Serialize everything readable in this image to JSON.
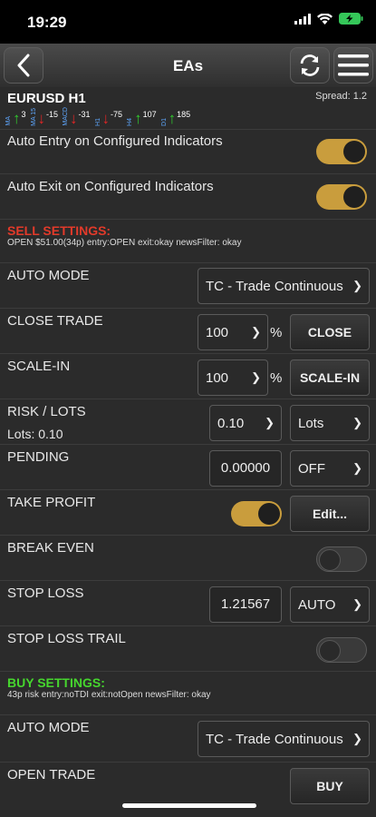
{
  "status": {
    "time": "19:29"
  },
  "nav": {
    "title": "EAs",
    "back_icon": "chevron-left-icon",
    "refresh_icon": "refresh-icon",
    "menu_icon": "hamburger-menu-icon"
  },
  "symbol": {
    "name": "EURUSD H1",
    "spread": "Spread: 1.2"
  },
  "indicators": [
    {
      "label": "MA",
      "dir": "up",
      "value": "3"
    },
    {
      "label": "MA 15",
      "dir": "down",
      "value": "-15"
    },
    {
      "label": "MACD",
      "dir": "down",
      "value": "-31"
    },
    {
      "label": "H1",
      "dir": "down",
      "value": "-75"
    },
    {
      "label": "H4",
      "dir": "up",
      "value": "107"
    },
    {
      "label": "D1",
      "dir": "up",
      "value": "185"
    }
  ],
  "auto_entry": {
    "label": "Auto Entry on Configured Indicators",
    "enabled": true
  },
  "auto_exit": {
    "label": "Auto Exit on Configured Indicators",
    "enabled": true
  },
  "sell": {
    "title": "SELL SETTINGS:",
    "summary": "OPEN $51.00(34p) entry:OPEN exit:okay newsFilter: okay",
    "auto_mode": {
      "label": "AUTO MODE",
      "value": "TC - Trade Continuous"
    },
    "close_trade": {
      "label": "CLOSE TRADE",
      "value": "100",
      "unit": "%",
      "button": "CLOSE"
    },
    "scale_in": {
      "label": "SCALE-IN",
      "value": "100",
      "unit": "%",
      "button": "SCALE-IN"
    },
    "risk": {
      "label": "RISK / LOTS",
      "sub": "Lots: 0.10",
      "value": "0.10",
      "type": "Lots"
    },
    "pending": {
      "label": "PENDING",
      "value": "0.00000",
      "mode": "OFF"
    },
    "take_profit": {
      "label": "TAKE PROFIT",
      "enabled": true,
      "button": "Edit..."
    },
    "break_even": {
      "label": "BREAK EVEN",
      "enabled": false
    },
    "stop_loss": {
      "label": "STOP LOSS",
      "value": "1.21567",
      "mode": "AUTO"
    },
    "stop_loss_trail": {
      "label": "STOP LOSS TRAIL",
      "enabled": false
    }
  },
  "buy": {
    "title": "BUY SETTINGS:",
    "summary": "43p risk entry:noTDI exit:notOpen newsFilter: okay",
    "auto_mode": {
      "label": "AUTO MODE",
      "value": "TC - Trade Continuous"
    },
    "open_trade": {
      "label": "OPEN TRADE",
      "button": "BUY"
    }
  },
  "colors": {
    "sell_title": "#e23a2a",
    "buy_title": "#46d62e",
    "toggle_on": "#c99d3d",
    "indicator_label": "#5fa8ff"
  }
}
